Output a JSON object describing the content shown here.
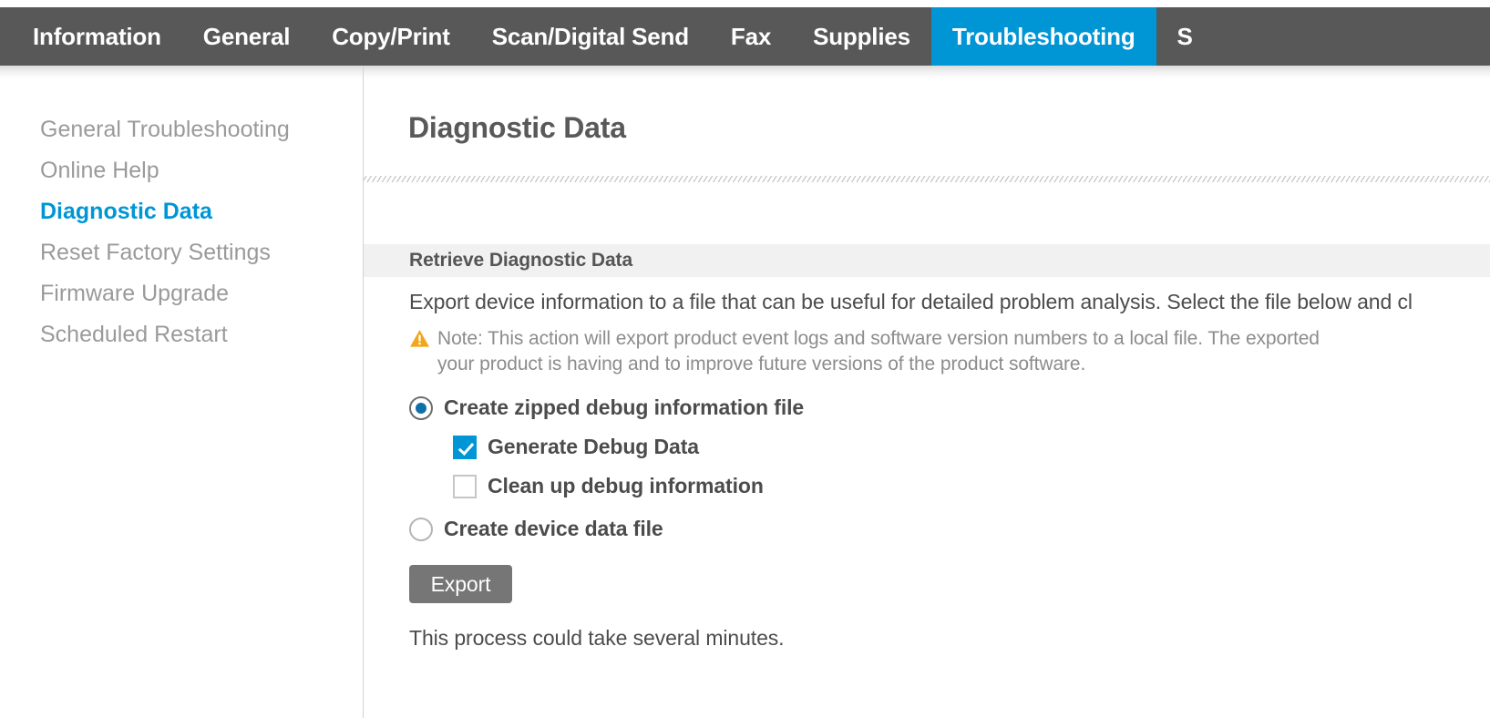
{
  "nav": {
    "items": [
      {
        "label": "Information",
        "active": false
      },
      {
        "label": "General",
        "active": false
      },
      {
        "label": "Copy/Print",
        "active": false
      },
      {
        "label": "Scan/Digital Send",
        "active": false
      },
      {
        "label": "Fax",
        "active": false
      },
      {
        "label": "Supplies",
        "active": false
      },
      {
        "label": "Troubleshooting",
        "active": true
      },
      {
        "label": "S",
        "active": false
      }
    ],
    "active_label": "Troubleshooting",
    "active_color": "#0096d6",
    "bar_color": "#585858"
  },
  "sidebar": {
    "items": [
      {
        "label": "General Troubleshooting",
        "active": false
      },
      {
        "label": "Online Help",
        "active": false
      },
      {
        "label": "Diagnostic Data",
        "active": true
      },
      {
        "label": "Reset Factory Settings",
        "active": false
      },
      {
        "label": "Firmware Upgrade",
        "active": false
      },
      {
        "label": "Scheduled Restart",
        "active": false
      }
    ],
    "active_color": "#0096d6"
  },
  "main": {
    "page_title": "Diagnostic Data",
    "section": {
      "banner_label": "Retrieve Diagnostic Data",
      "description": "Export device information to a file that can be useful for detailed problem analysis. Select the file below and cl",
      "note": {
        "icon": "warning-triangle-icon",
        "icon_color": "#f2a71b",
        "line1": "Note: This action will export product event logs and software version numbers to a local file. The exported",
        "line2": "your product is having and to improve future versions of the product software."
      },
      "options": [
        {
          "type": "radio",
          "label": "Create zipped debug information file",
          "checked": true,
          "indent": false
        },
        {
          "type": "checkbox",
          "label": "Generate Debug Data",
          "checked": true,
          "indent": true
        },
        {
          "type": "checkbox",
          "label": "Clean up debug information",
          "checked": false,
          "indent": true
        },
        {
          "type": "radio",
          "label": "Create device data file",
          "checked": false,
          "indent": false
        }
      ],
      "export_button": "Export",
      "footnote": "This process could take several minutes."
    }
  }
}
